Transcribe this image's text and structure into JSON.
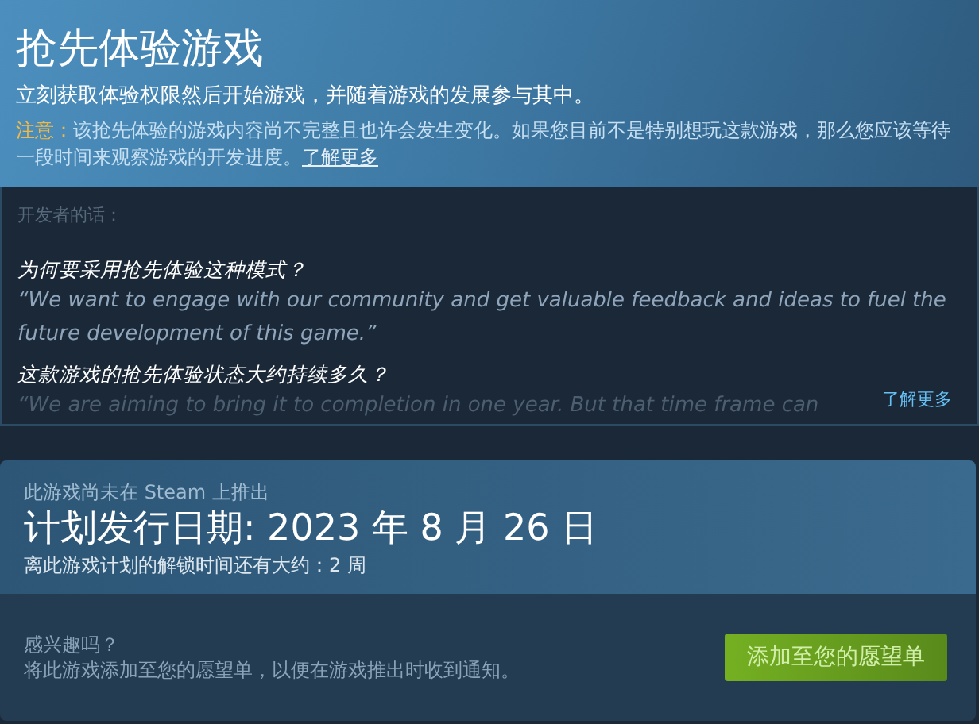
{
  "early_access": {
    "title": "抢先体验游戏",
    "subtitle": "立刻获取体验权限然后开始游戏，并随着游戏的发展参与其中。",
    "notice_label": "注意：",
    "notice_text": "该抢先体验的游戏内容尚不完整且也许会发生变化。如果您目前不是特别想玩这款游戏，那么您应该等待一段时间来观察游戏的开发进度。",
    "notice_link": "了解更多"
  },
  "developer_notes": {
    "heading": "开发者的话：",
    "items": [
      {
        "question": "为何要采用抢先体验这种模式？",
        "answer": "“We want to engage with our community and get valuable feedback and ideas to fuel the future development of this game.”"
      },
      {
        "question": "这款游戏的抢先体验状态大约持续多久？",
        "answer": "“We are aiming to bring it to completion in one year. But that time frame can"
      }
    ],
    "more_link": "了解更多"
  },
  "release": {
    "status": "此游戏尚未在 Steam 上推出",
    "date": "计划发行日期: 2023 年 8 月 26 日",
    "countdown": "离此游戏计划的解锁时间还有大约：2 周"
  },
  "wishlist": {
    "question": "感兴趣吗？",
    "text": "将此游戏添加至您的愿望单，以便在游戏推出时收到通知。",
    "button": "添加至您的愿望单"
  }
}
